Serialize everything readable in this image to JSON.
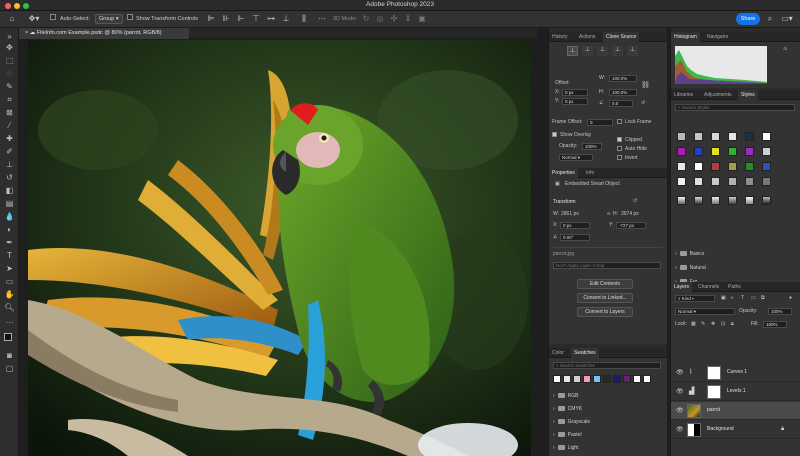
{
  "app": {
    "title": "Adobe Photoshop 2023"
  },
  "options_bar": {
    "auto_select_label": "Auto-Select:",
    "auto_select_value": "Group",
    "transform_controls_label": "Show Transform Controls",
    "mode_3d_label": "3D Mode:",
    "share_label": "Share"
  },
  "document": {
    "tab_title": "FileInfo.com Example.psdc @ 80% (parrot, RGB/8)"
  },
  "clone_source": {
    "tabs": [
      "History",
      "Actions",
      "Clone Source"
    ],
    "offset_label": "Offset:",
    "x_label": "X:",
    "x_value": "0 px",
    "y_label": "Y:",
    "y_value": "0 px",
    "w_label": "W:",
    "w_value": "100.0%",
    "h_label": "H:",
    "h_value": "100.0%",
    "angle_value": "0.0",
    "frame_offset_label": "Frame Offset:",
    "frame_offset_value": "0",
    "lock_frame_label": "Lock Frame",
    "show_overlay_label": "Show Overlay",
    "opacity_label": "Opacity:",
    "opacity_value": "100%",
    "blend_value": "Normal",
    "clipped_label": "Clipped",
    "auto_hide_label": "Auto Hide",
    "invert_label": "Invert"
  },
  "properties": {
    "tabs": [
      "Properties",
      "Info"
    ],
    "object_label": "Embedded Smart Object",
    "transform_label": "Transform",
    "w_label": "W:",
    "w_value": "2861 px",
    "h_label": "H:",
    "h_value": "3974 px",
    "x_label": "X:",
    "x_value": "0 px",
    "y_label": "Y:",
    "y_value": "-727 px",
    "angle_value": "0.00°",
    "file_name": "parrot.jpg",
    "layer_comps_placeholder": "Don't Apply Layer Comp",
    "edit_contents_label": "Edit Contents",
    "convert_linked_label": "Convert to Linked...",
    "convert_layers_label": "Convert to Layers"
  },
  "swatches": {
    "tabs": [
      "Color",
      "Swatches"
    ],
    "search_placeholder": "Search Swatches",
    "recent_colors": [
      "#ffffff",
      "#e8e8e8",
      "#d0d0d0",
      "#f49ac1",
      "#6ec6f0",
      "#2a2a2a",
      "#1a1a7a",
      "#6b1e6b",
      "#ffffff",
      "#ffffff"
    ],
    "folders": [
      "RGB",
      "CMYK",
      "Grayscale",
      "Pastel",
      "Light"
    ]
  },
  "histogram": {
    "tabs": [
      "Histogram",
      "Navigator"
    ]
  },
  "styles": {
    "tabs": [
      "Libraries",
      "Adjustments",
      "Styles"
    ],
    "search_placeholder": "Search Styles",
    "rows": [
      [
        "#b8b8b8",
        "#c8c8c8",
        "#d8d8d8",
        "#e4e4e4",
        "#1c2f4a",
        "#ffffff"
      ],
      [
        "#b01ab0",
        "#2040d0",
        "#e0e020",
        "#30b030",
        "#9a30c0",
        "#d0d0d0"
      ],
      [
        "#e8e8e8",
        "#ffffff",
        "#b04040",
        "#a0a040",
        "#2a8a2a",
        "#3050c0"
      ],
      [
        "#f0f0f0",
        "#e0e0e0",
        "#c8c8c8",
        "#b0b0b0",
        "#909090",
        "#787878"
      ]
    ],
    "folders": [
      "Basics",
      "Natural",
      "Fur"
    ]
  },
  "layers": {
    "tabs": [
      "Layers",
      "Channels",
      "Paths"
    ],
    "kind_value": "Kind",
    "blend_value": "Normal",
    "opacity_label": "Opacity:",
    "opacity_value": "100%",
    "lock_label": "Lock:",
    "fill_label": "Fill:",
    "fill_value": "100%",
    "items": [
      {
        "name": "Curves 1"
      },
      {
        "name": "Levels 1"
      },
      {
        "name": "parrot"
      },
      {
        "name": "Background"
      }
    ]
  }
}
